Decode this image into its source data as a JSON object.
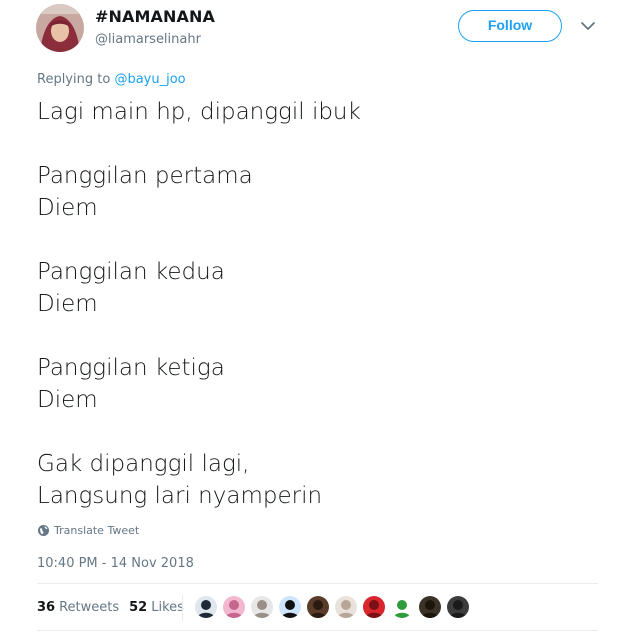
{
  "tweet": {
    "display_name": "#NAMANANA",
    "handle": "@liamarselinahr",
    "follow_label": "Follow",
    "replying_prefix": "Replying to ",
    "replying_to": "@bayu_joo",
    "lines": [
      "Lagi main hp, dipanggil ibuk",
      "",
      "Panggilan pertama",
      "Diem",
      "",
      "Panggilan kedua",
      "Diem",
      "",
      "Panggilan ketiga",
      "Diem",
      "",
      "Gak dipanggil lagi,",
      "Langsung lari nyamperin"
    ],
    "translate_label": "Translate Tweet",
    "timestamp": "10:40 PM - 14 Nov 2018",
    "retweets_count": "36",
    "retweets_label": "Retweets",
    "likes_count": "52",
    "likes_label": "Likes"
  },
  "colors": {
    "accent": "#1da1f2",
    "secondary_text": "#657786",
    "primary_text": "#14171a",
    "divider": "#e6ecf0"
  },
  "icons": {
    "more": "chevron-down-icon",
    "translate": "globe-icon"
  },
  "likers": [
    {
      "bg": "#dfe6ee",
      "fg": "#1f2a36"
    },
    {
      "bg": "#f3b8cf",
      "fg": "#c4668e"
    },
    {
      "bg": "#e7e7e7",
      "fg": "#9a8f88"
    },
    {
      "bg": "#cfe4ff",
      "fg": "#111111"
    },
    {
      "bg": "#5a3b2a",
      "fg": "#2b1a10"
    },
    {
      "bg": "#e9e2dc",
      "fg": "#b9a598"
    },
    {
      "bg": "#d9262e",
      "fg": "#7a0f15"
    },
    {
      "bg": "#ffffff",
      "fg": "#2f9b3b"
    },
    {
      "bg": "#3a3226",
      "fg": "#1c150c"
    },
    {
      "bg": "#3c3c3c",
      "fg": "#1a1a1a"
    }
  ]
}
